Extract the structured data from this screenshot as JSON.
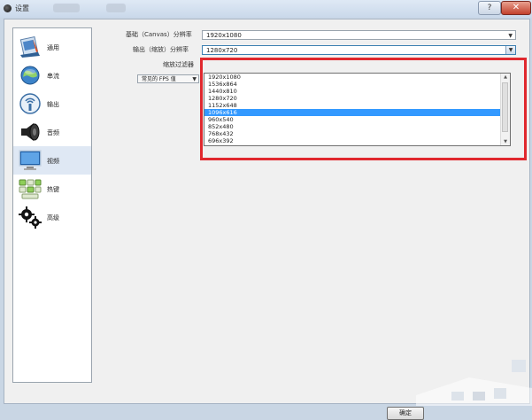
{
  "window": {
    "title": "设置",
    "help_glyph": "?",
    "close_glyph": "✕"
  },
  "sidebar": {
    "items": [
      {
        "label": "通用",
        "icon": "general-icon"
      },
      {
        "label": "串流",
        "icon": "stream-icon"
      },
      {
        "label": "输出",
        "icon": "output-icon"
      },
      {
        "label": "音频",
        "icon": "audio-icon"
      },
      {
        "label": "视频",
        "icon": "video-icon",
        "selected": true
      },
      {
        "label": "热键",
        "icon": "hotkeys-icon"
      },
      {
        "label": "高级",
        "icon": "advanced-icon"
      }
    ]
  },
  "video": {
    "base_resolution_label": "基础（Canvas）分辨率",
    "base_resolution_value": "1920x1080",
    "output_resolution_label": "输出（缩放）分辨率",
    "output_resolution_value": "1280x720",
    "downscale_filter_label": "缩放过滤器",
    "fps_type_value": "常见的 FPS 值",
    "resolution_options": [
      "1920x1080",
      "1536x864",
      "1440x810",
      "1280x720",
      "1152x648",
      "1096x616",
      "960x540",
      "852x480",
      "768x432",
      "696x392"
    ],
    "highlighted_option": "1096x616"
  },
  "footer": {
    "ok_label": "确定"
  },
  "colors": {
    "highlight_border": "#e0282e",
    "selection": "#3399ff"
  }
}
